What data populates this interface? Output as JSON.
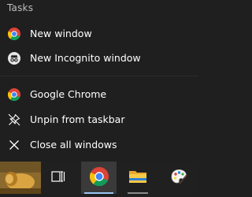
{
  "jumplist": {
    "section_title": "Tasks",
    "tasks": [
      {
        "label": "New window",
        "icon": "chrome-icon"
      },
      {
        "label": "New Incognito window",
        "icon": "incognito-icon"
      }
    ],
    "app_actions": [
      {
        "label": "Google Chrome",
        "icon": "chrome-icon"
      },
      {
        "label": "Unpin from taskbar",
        "icon": "unpin-icon"
      },
      {
        "label": "Close all windows",
        "icon": "close-icon"
      }
    ]
  },
  "taskbar": {
    "items": [
      {
        "name": "lion-king-app",
        "icon": "lion-thumbnail-icon"
      },
      {
        "name": "task-view",
        "icon": "task-view-icon"
      },
      {
        "name": "google-chrome",
        "icon": "chrome-icon",
        "active": true
      },
      {
        "name": "file-explorer",
        "icon": "folder-icon"
      },
      {
        "name": "paint",
        "icon": "paint-palette-icon"
      }
    ]
  },
  "colors": {
    "background": "#1f1f1f",
    "taskbar": "#202020",
    "active_indicator": "#9ac6f3",
    "chrome_red": "#db4437",
    "chrome_yellow": "#f4c20d",
    "chrome_green": "#0f9d58",
    "chrome_blue": "#4285f4"
  }
}
